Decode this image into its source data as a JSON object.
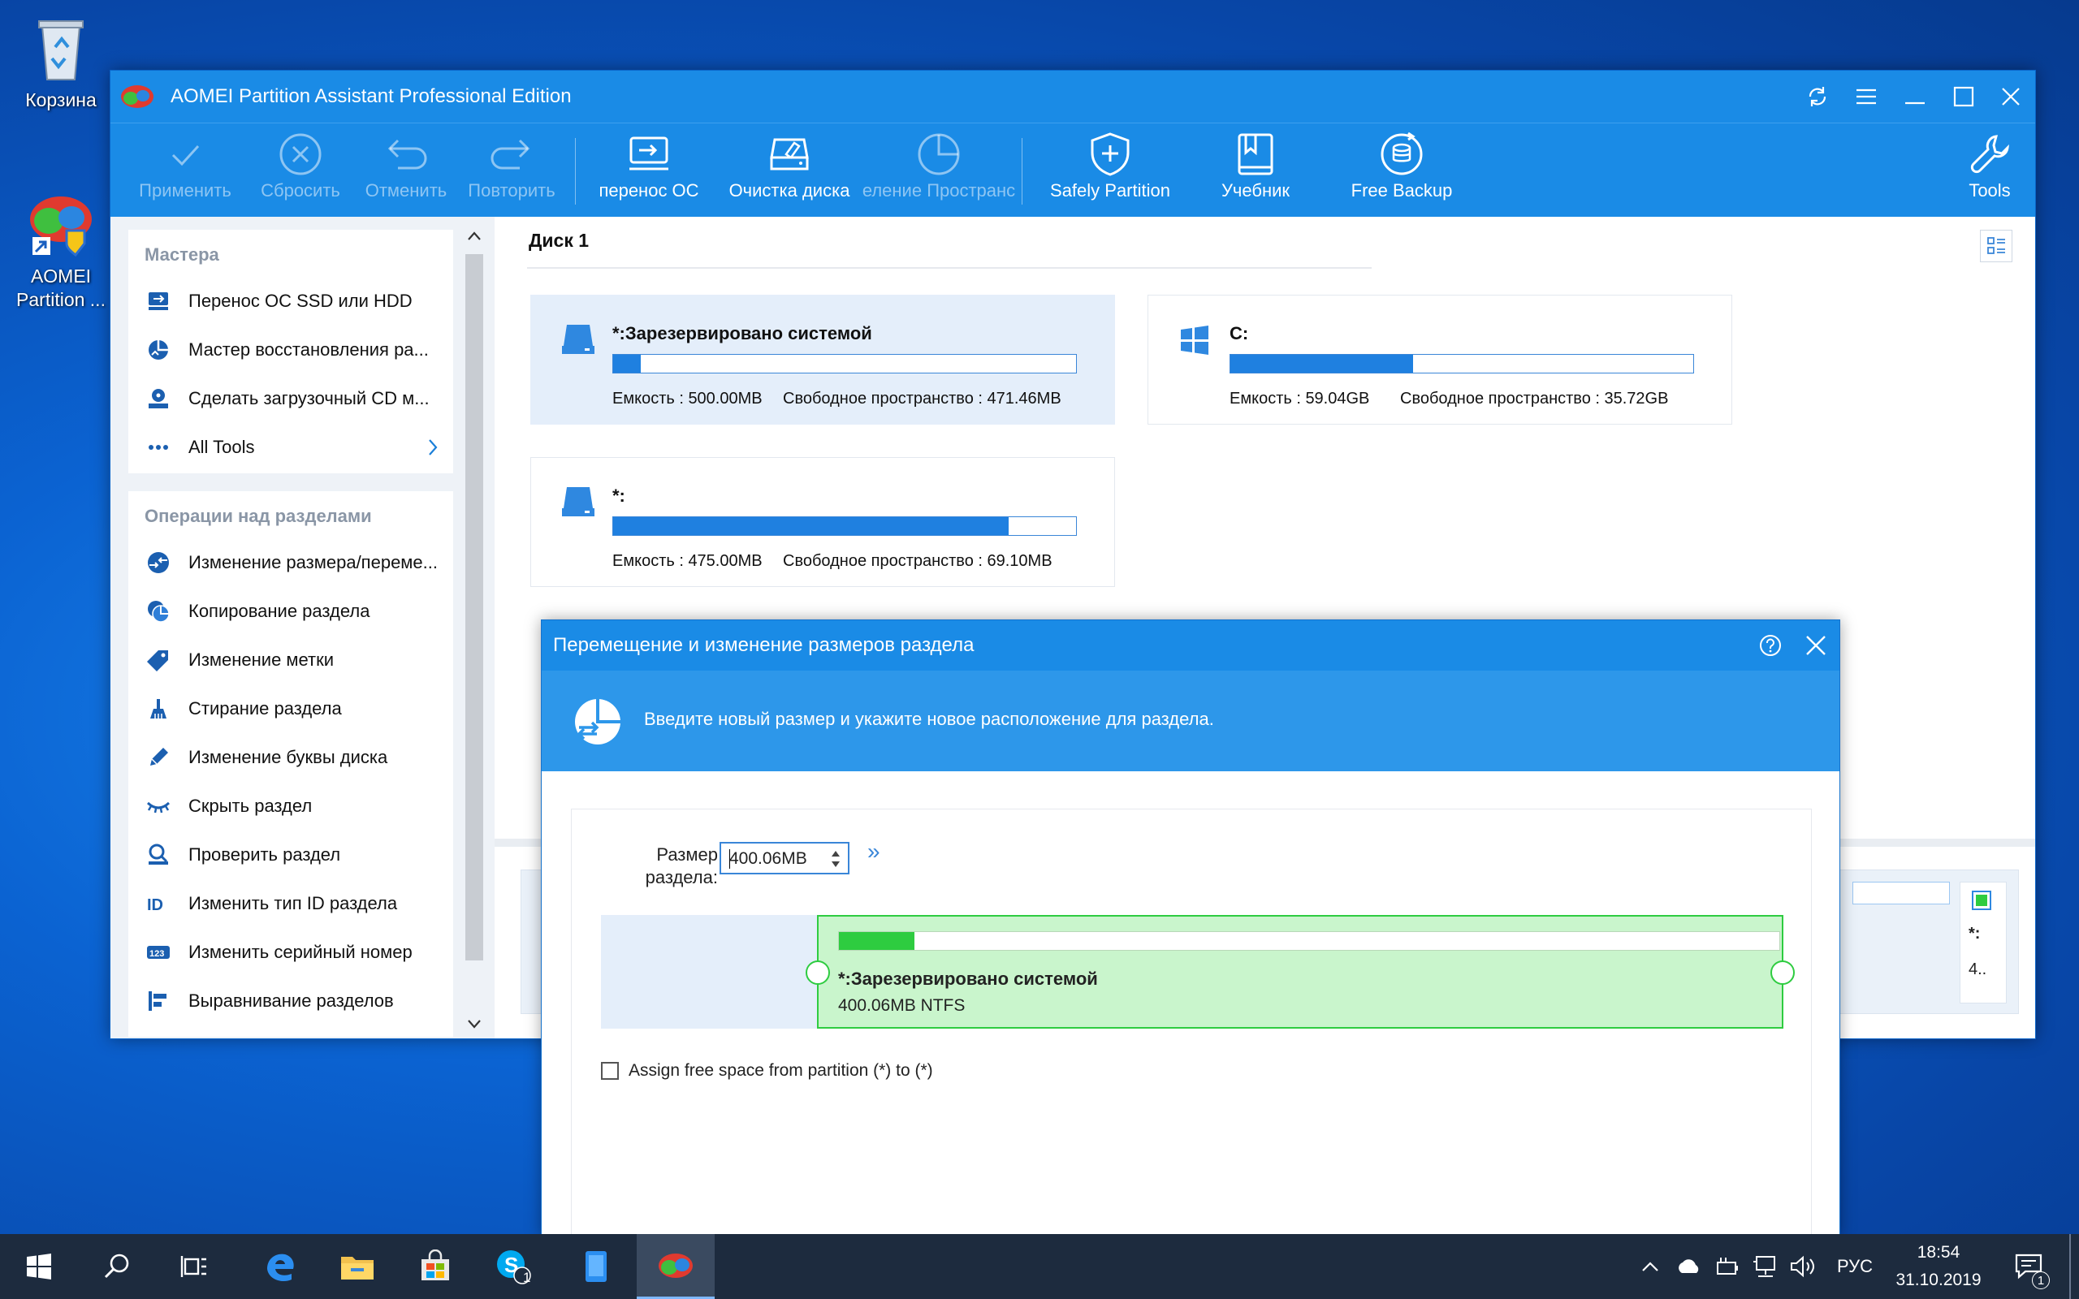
{
  "desktop": {
    "icons": [
      {
        "label": "Корзина"
      },
      {
        "label": "AOMEI Partition ..."
      }
    ]
  },
  "app": {
    "title": "AOMEI Partition Assistant Professional Edition",
    "toolbar": {
      "apply": "Применить",
      "discard": "Сбросить",
      "undo": "Отменить",
      "redo": "Повторить",
      "migrate_os": "перенос ОС",
      "wipe_disk": "Очистка диска",
      "allocate_space": "еление Пространс",
      "safely_partition": "Safely Partition",
      "tutorial": "Учебник",
      "free_backup": "Free Backup",
      "tools": "Tools"
    },
    "sidebar": {
      "wizards_title": "Мастера",
      "wizards": [
        {
          "label": "Перенос ОС SSD или HDD"
        },
        {
          "label": "Мастер восстановления ра..."
        },
        {
          "label": "Сделать загрузочный CD м..."
        },
        {
          "label": "All Tools"
        }
      ],
      "operations_title": "Операции над разделами",
      "operations": [
        {
          "label": "Изменение размера/переме..."
        },
        {
          "label": "Копирование раздела"
        },
        {
          "label": "Изменение метки"
        },
        {
          "label": "Стирание раздела"
        },
        {
          "label": "Изменение буквы диска"
        },
        {
          "label": "Скрыть раздел"
        },
        {
          "label": "Проверить раздел"
        },
        {
          "label": "Изменить тип ID раздела"
        },
        {
          "label": "Изменить серийный номер"
        },
        {
          "label": "Выравнивание разделов"
        }
      ]
    },
    "disk": {
      "title": "Диск 1",
      "partitions": [
        {
          "name": "*:Зарезервировано системой",
          "capacity": "Емкость : 500.00MB",
          "free": "Свободное пространство : 471.46MB",
          "used_fraction": 0.06
        },
        {
          "name": "C:",
          "capacity": "Емкость : 59.04GB",
          "free": "Свободное пространство : 35.72GB",
          "used_fraction": 0.395
        },
        {
          "name": "*:",
          "capacity": "Емкость : 475.00MB",
          "free": "Свободное пространство : 69.10MB",
          "used_fraction": 0.855
        }
      ],
      "strip_label_1": "*:",
      "strip_label_2": "4.."
    }
  },
  "dialog": {
    "title": "Перемещение и изменение размеров раздела",
    "description": "Введите новый размер и укажите новое расположение для раздела.",
    "size_label_line1": "Размер",
    "size_label_line2": "раздела:",
    "size_value": "400.06MB",
    "more_symbol": "»",
    "partition_name": "*:Зарезервировано системой",
    "partition_info": "400.06MB NTFS",
    "used_fraction": 0.08,
    "checkbox_label": "Assign free space from partition (*) to (*)",
    "checkbox_checked": false
  },
  "taskbar": {
    "language": "РУС",
    "time": "18:54",
    "date": "31.10.2019",
    "skype_badge": "1",
    "notification_badge": "1"
  },
  "colors": {
    "accent": "#1a8be6",
    "used_bar": "#1f80e0",
    "green_fill": "#2ecc40",
    "green_bg": "#c9f5cc",
    "taskbar": "#1d2b3e"
  }
}
